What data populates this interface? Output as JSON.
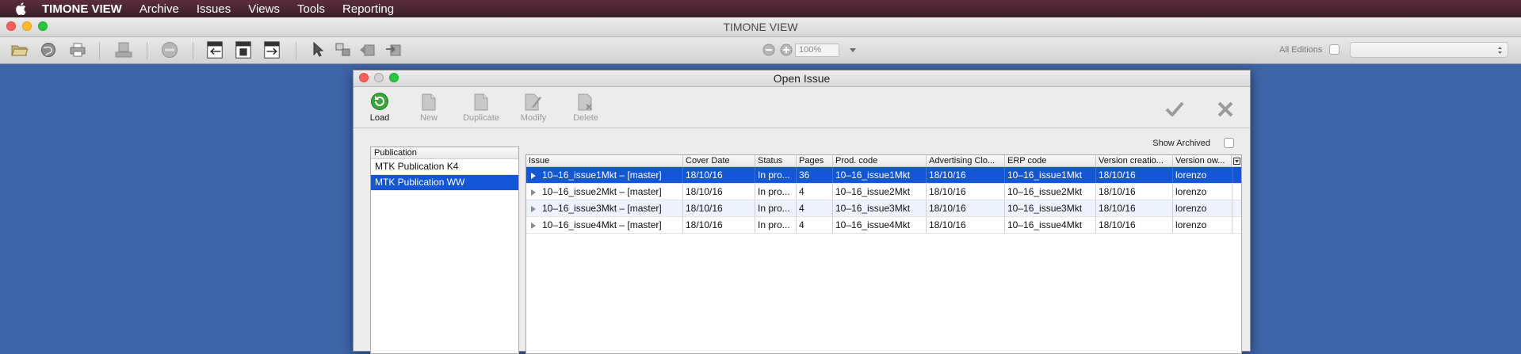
{
  "menubar": {
    "app_name": "TIMONE VIEW",
    "items": [
      "Archive",
      "Issues",
      "Views",
      "Tools",
      "Reporting"
    ]
  },
  "window": {
    "title": "TIMONE VIEW",
    "zoom_placeholder": "100%",
    "all_editions_label": "All Editions"
  },
  "dialog": {
    "title": "Open Issue",
    "tools": {
      "load": "Load",
      "new": "New",
      "duplicate": "Duplicate",
      "modify": "Modify",
      "delete": "Delete"
    },
    "show_archived_label": "Show Archived",
    "publication_header": "Publication",
    "publications": [
      "MTK Publication K4",
      "MTK Publication WW"
    ],
    "selected_publication": 1,
    "columns": [
      "Issue",
      "Cover Date",
      "Status",
      "Pages",
      "Prod. code",
      "Advertising Clo...",
      "ERP code",
      "Version creatio...",
      "Version ow..."
    ],
    "rows": [
      [
        "10–16_issue1Mkt – [master]",
        "18/10/16",
        "In pro...",
        "36",
        "10–16_issue1Mkt",
        "18/10/16",
        "10–16_issue1Mkt",
        "18/10/16",
        "lorenzo"
      ],
      [
        "10–16_issue2Mkt – [master]",
        "18/10/16",
        "In pro...",
        "4",
        "10–16_issue2Mkt",
        "18/10/16",
        "10–16_issue2Mkt",
        "18/10/16",
        "lorenzo"
      ],
      [
        "10–16_issue3Mkt – [master]",
        "18/10/16",
        "In pro...",
        "4",
        "10–16_issue3Mkt",
        "18/10/16",
        "10–16_issue3Mkt",
        "18/10/16",
        "lorenzo"
      ],
      [
        "10–16_issue4Mkt – [master]",
        "18/10/16",
        "In pro...",
        "4",
        "10–16_issue4Mkt",
        "18/10/16",
        "10–16_issue4Mkt",
        "18/10/16",
        "lorenzo"
      ]
    ],
    "selected_row": 0
  },
  "colors": {
    "desktop": "#3d64a8",
    "selection": "#1457d6",
    "menubar": "#4a2634"
  }
}
